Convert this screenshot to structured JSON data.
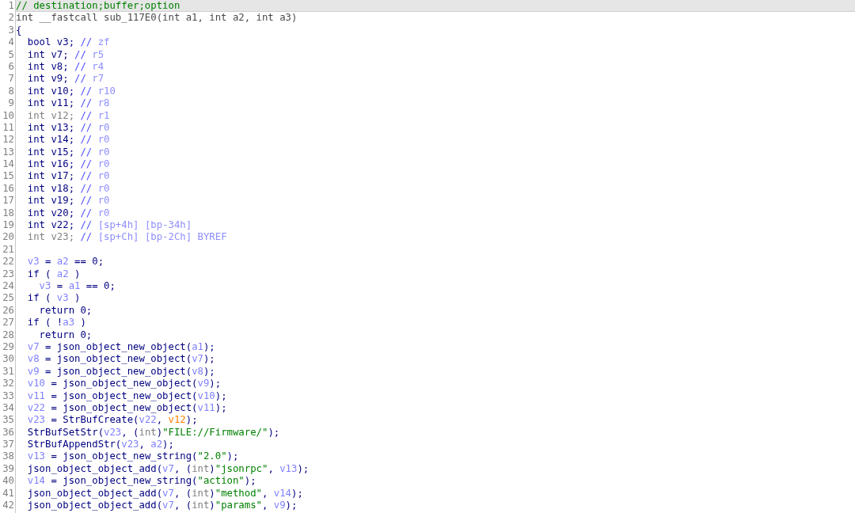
{
  "lines": [
    {
      "number": "1",
      "current": true,
      "tokens": [
        {
          "kind": "note",
          "text": "// destination;buffer;option"
        }
      ]
    },
    {
      "number": "2",
      "current": false,
      "tokens": [
        {
          "kind": "plain",
          "text": "int __fastcall sub_117E0(int a1, int a2, int a3)"
        }
      ]
    },
    {
      "number": "3",
      "current": false,
      "tokens": [
        {
          "kind": "code",
          "text": "{"
        }
      ]
    },
    {
      "number": "4",
      "current": false,
      "tokens": [
        {
          "kind": "code",
          "text": "  bool v3; "
        },
        {
          "kind": "comment",
          "text": "// "
        },
        {
          "kind": "reg",
          "text": "zf"
        }
      ]
    },
    {
      "number": "5",
      "current": false,
      "tokens": [
        {
          "kind": "code",
          "text": "  int v7; "
        },
        {
          "kind": "comment",
          "text": "// "
        },
        {
          "kind": "reg",
          "text": "r5"
        }
      ]
    },
    {
      "number": "6",
      "current": false,
      "tokens": [
        {
          "kind": "code",
          "text": "  int v8; "
        },
        {
          "kind": "comment",
          "text": "// "
        },
        {
          "kind": "reg",
          "text": "r4"
        }
      ]
    },
    {
      "number": "7",
      "current": false,
      "tokens": [
        {
          "kind": "code",
          "text": "  int v9; "
        },
        {
          "kind": "comment",
          "text": "// "
        },
        {
          "kind": "reg",
          "text": "r7"
        }
      ]
    },
    {
      "number": "8",
      "current": false,
      "tokens": [
        {
          "kind": "code",
          "text": "  int v10; "
        },
        {
          "kind": "comment",
          "text": "// "
        },
        {
          "kind": "reg",
          "text": "r10"
        }
      ]
    },
    {
      "number": "9",
      "current": false,
      "tokens": [
        {
          "kind": "code",
          "text": "  int v11; "
        },
        {
          "kind": "comment",
          "text": "// "
        },
        {
          "kind": "reg",
          "text": "r8"
        }
      ]
    },
    {
      "number": "10",
      "current": false,
      "tokens": [
        {
          "kind": "dim",
          "text": "  int v12; "
        },
        {
          "kind": "comment",
          "text": "// "
        },
        {
          "kind": "reg",
          "text": "r1"
        }
      ]
    },
    {
      "number": "11",
      "current": false,
      "tokens": [
        {
          "kind": "code",
          "text": "  int v13; "
        },
        {
          "kind": "comment",
          "text": "// "
        },
        {
          "kind": "reg",
          "text": "r0"
        }
      ]
    },
    {
      "number": "12",
      "current": false,
      "tokens": [
        {
          "kind": "code",
          "text": "  int v14; "
        },
        {
          "kind": "comment",
          "text": "// "
        },
        {
          "kind": "reg",
          "text": "r0"
        }
      ]
    },
    {
      "number": "13",
      "current": false,
      "tokens": [
        {
          "kind": "code",
          "text": "  int v15; "
        },
        {
          "kind": "comment",
          "text": "// "
        },
        {
          "kind": "reg",
          "text": "r0"
        }
      ]
    },
    {
      "number": "14",
      "current": false,
      "tokens": [
        {
          "kind": "code",
          "text": "  int v16; "
        },
        {
          "kind": "comment",
          "text": "// "
        },
        {
          "kind": "reg",
          "text": "r0"
        }
      ]
    },
    {
      "number": "15",
      "current": false,
      "tokens": [
        {
          "kind": "code",
          "text": "  int v17; "
        },
        {
          "kind": "comment",
          "text": "// "
        },
        {
          "kind": "reg",
          "text": "r0"
        }
      ]
    },
    {
      "number": "16",
      "current": false,
      "tokens": [
        {
          "kind": "code",
          "text": "  int v18; "
        },
        {
          "kind": "comment",
          "text": "// "
        },
        {
          "kind": "reg",
          "text": "r0"
        }
      ]
    },
    {
      "number": "17",
      "current": false,
      "tokens": [
        {
          "kind": "code",
          "text": "  int v19; "
        },
        {
          "kind": "comment",
          "text": "// "
        },
        {
          "kind": "reg",
          "text": "r0"
        }
      ]
    },
    {
      "number": "18",
      "current": false,
      "tokens": [
        {
          "kind": "code",
          "text": "  int v20; "
        },
        {
          "kind": "comment",
          "text": "// "
        },
        {
          "kind": "reg",
          "text": "r0"
        }
      ]
    },
    {
      "number": "19",
      "current": false,
      "tokens": [
        {
          "kind": "code",
          "text": "  int v22; "
        },
        {
          "kind": "comment",
          "text": "// "
        },
        {
          "kind": "reg",
          "text": "[sp+4h] [bp-34h]"
        }
      ]
    },
    {
      "number": "20",
      "current": false,
      "tokens": [
        {
          "kind": "dim",
          "text": "  int v23; "
        },
        {
          "kind": "comment",
          "text": "// "
        },
        {
          "kind": "reg",
          "text": "[sp+Ch] [bp-2Ch] BYREF"
        }
      ]
    },
    {
      "number": "21",
      "current": false
    },
    {
      "number": "22",
      "current": false,
      "tokens": [
        {
          "kind": "var",
          "text": "  v3"
        },
        {
          "kind": "code",
          "text": " = "
        },
        {
          "kind": "var",
          "text": "a2"
        },
        {
          "kind": "code",
          "text": " == 0;"
        }
      ]
    },
    {
      "number": "23",
      "current": false,
      "tokens": [
        {
          "kind": "code",
          "text": "  if ( "
        },
        {
          "kind": "var",
          "text": "a2"
        },
        {
          "kind": "code",
          "text": " )"
        }
      ]
    },
    {
      "number": "24",
      "current": false,
      "tokens": [
        {
          "kind": "var",
          "text": "    v3"
        },
        {
          "kind": "code",
          "text": " = "
        },
        {
          "kind": "var",
          "text": "a1"
        },
        {
          "kind": "code",
          "text": " == 0;"
        }
      ]
    },
    {
      "number": "25",
      "current": false,
      "tokens": [
        {
          "kind": "code",
          "text": "  if ( "
        },
        {
          "kind": "var",
          "text": "v3"
        },
        {
          "kind": "code",
          "text": " )"
        }
      ]
    },
    {
      "number": "26",
      "current": false,
      "tokens": [
        {
          "kind": "code",
          "text": "    return 0;"
        }
      ]
    },
    {
      "number": "27",
      "current": false,
      "tokens": [
        {
          "kind": "code",
          "text": "  if ( !"
        },
        {
          "kind": "var",
          "text": "a3"
        },
        {
          "kind": "code",
          "text": " )"
        }
      ]
    },
    {
      "number": "28",
      "current": false,
      "tokens": [
        {
          "kind": "code",
          "text": "    return 0;"
        }
      ]
    },
    {
      "number": "29",
      "current": false,
      "tokens": [
        {
          "kind": "var",
          "text": "  v7"
        },
        {
          "kind": "code",
          "text": " = json_object_new_object("
        },
        {
          "kind": "var",
          "text": "a1"
        },
        {
          "kind": "code",
          "text": ");"
        }
      ]
    },
    {
      "number": "30",
      "current": false,
      "tokens": [
        {
          "kind": "var",
          "text": "  v8"
        },
        {
          "kind": "code",
          "text": " = json_object_new_object("
        },
        {
          "kind": "var",
          "text": "v7"
        },
        {
          "kind": "code",
          "text": ");"
        }
      ]
    },
    {
      "number": "31",
      "current": false,
      "tokens": [
        {
          "kind": "var",
          "text": "  v9"
        },
        {
          "kind": "code",
          "text": " = json_object_new_object("
        },
        {
          "kind": "var",
          "text": "v8"
        },
        {
          "kind": "code",
          "text": ");"
        }
      ]
    },
    {
      "number": "32",
      "current": false,
      "tokens": [
        {
          "kind": "var",
          "text": "  v10"
        },
        {
          "kind": "code",
          "text": " = json_object_new_object("
        },
        {
          "kind": "var",
          "text": "v9"
        },
        {
          "kind": "code",
          "text": ");"
        }
      ]
    },
    {
      "number": "33",
      "current": false,
      "tokens": [
        {
          "kind": "var",
          "text": "  v11"
        },
        {
          "kind": "code",
          "text": " = json_object_new_object("
        },
        {
          "kind": "var",
          "text": "v10"
        },
        {
          "kind": "code",
          "text": ");"
        }
      ]
    },
    {
      "number": "34",
      "current": false,
      "tokens": [
        {
          "kind": "var",
          "text": "  v22"
        },
        {
          "kind": "code",
          "text": " = json_object_new_object("
        },
        {
          "kind": "var",
          "text": "v11"
        },
        {
          "kind": "code",
          "text": ");"
        }
      ]
    },
    {
      "number": "35",
      "current": false,
      "tokens": [
        {
          "kind": "var",
          "text": "  v23"
        },
        {
          "kind": "code",
          "text": " = StrBufCreate("
        },
        {
          "kind": "var",
          "text": "v22"
        },
        {
          "kind": "code",
          "text": ", "
        },
        {
          "kind": "warn",
          "text": "v12"
        },
        {
          "kind": "code",
          "text": ");"
        }
      ]
    },
    {
      "number": "36",
      "current": false,
      "tokens": [
        {
          "kind": "code",
          "text": "  StrBufSetStr("
        },
        {
          "kind": "var",
          "text": "v23"
        },
        {
          "kind": "code",
          "text": ", ("
        },
        {
          "kind": "dim",
          "text": "int"
        },
        {
          "kind": "code",
          "text": ")"
        },
        {
          "kind": "str",
          "text": "\"FILE://Firmware/\""
        },
        {
          "kind": "code",
          "text": ");"
        }
      ]
    },
    {
      "number": "37",
      "current": false,
      "tokens": [
        {
          "kind": "code",
          "text": "  StrBufAppendStr("
        },
        {
          "kind": "var",
          "text": "v23"
        },
        {
          "kind": "code",
          "text": ", "
        },
        {
          "kind": "var",
          "text": "a2"
        },
        {
          "kind": "code",
          "text": ");"
        }
      ]
    },
    {
      "number": "38",
      "current": false,
      "tokens": [
        {
          "kind": "var",
          "text": "  v13"
        },
        {
          "kind": "code",
          "text": " = json_object_new_string("
        },
        {
          "kind": "str",
          "text": "\"2.0\""
        },
        {
          "kind": "code",
          "text": ");"
        }
      ]
    },
    {
      "number": "39",
      "current": false,
      "tokens": [
        {
          "kind": "code",
          "text": "  json_object_object_add("
        },
        {
          "kind": "var",
          "text": "v7"
        },
        {
          "kind": "code",
          "text": ", ("
        },
        {
          "kind": "dim",
          "text": "int"
        },
        {
          "kind": "code",
          "text": ")"
        },
        {
          "kind": "str",
          "text": "\"jsonrpc\""
        },
        {
          "kind": "code",
          "text": ", "
        },
        {
          "kind": "var",
          "text": "v13"
        },
        {
          "kind": "code",
          "text": ");"
        }
      ]
    },
    {
      "number": "40",
      "current": false,
      "tokens": [
        {
          "kind": "var",
          "text": "  v14"
        },
        {
          "kind": "code",
          "text": " = json_object_new_string("
        },
        {
          "kind": "str",
          "text": "\"action\""
        },
        {
          "kind": "code",
          "text": ");"
        }
      ]
    },
    {
      "number": "41",
      "current": false,
      "tokens": [
        {
          "kind": "code",
          "text": "  json_object_object_add("
        },
        {
          "kind": "var",
          "text": "v7"
        },
        {
          "kind": "code",
          "text": ", ("
        },
        {
          "kind": "dim",
          "text": "int"
        },
        {
          "kind": "code",
          "text": ")"
        },
        {
          "kind": "str",
          "text": "\"method\""
        },
        {
          "kind": "code",
          "text": ", "
        },
        {
          "kind": "var",
          "text": "v14"
        },
        {
          "kind": "code",
          "text": ");"
        }
      ]
    },
    {
      "number": "42",
      "current": false,
      "tokens": [
        {
          "kind": "code",
          "text": "  json_object_object_add("
        },
        {
          "kind": "var",
          "text": "v7"
        },
        {
          "kind": "code",
          "text": ", ("
        },
        {
          "kind": "dim",
          "text": "int"
        },
        {
          "kind": "code",
          "text": ")"
        },
        {
          "kind": "str",
          "text": "\"params\""
        },
        {
          "kind": "code",
          "text": ", "
        },
        {
          "kind": "var",
          "text": "v9"
        },
        {
          "kind": "code",
          "text": ");"
        }
      ]
    }
  ]
}
